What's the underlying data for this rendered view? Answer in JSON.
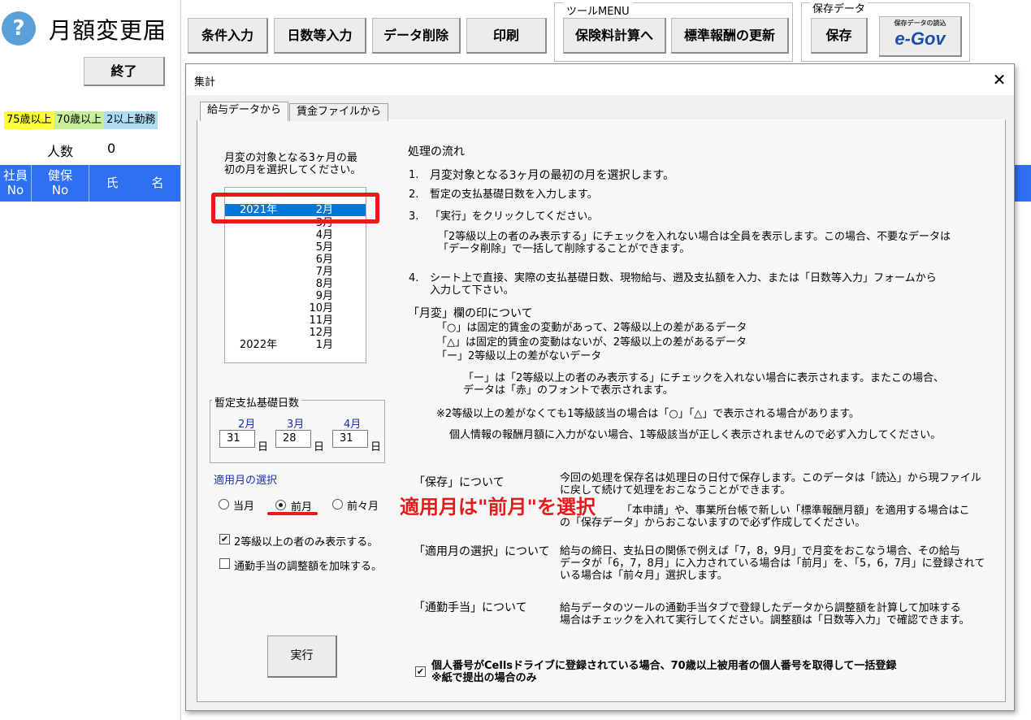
{
  "sheet": {
    "title": "月額変更届",
    "help_glyph": "?",
    "end_button": "終了",
    "age_legend": [
      "75歳以上",
      "70歳以上",
      "2以上勤務"
    ],
    "count_label": "人数",
    "count_value": "0",
    "headers": [
      "社員\nNo",
      "健保\nNo",
      "氏",
      "名"
    ]
  },
  "toolbar": {
    "buttons": [
      "条件入力",
      "日数等入力",
      "データ削除",
      "印刷"
    ],
    "tool_menu_label": "ツールMENU",
    "tool_menu_buttons": [
      "保険料計算へ",
      "標準報酬の更新"
    ],
    "save_group_label": "保存データ",
    "save_button": "保存",
    "egov_caption": "保存データの読込",
    "egov_logo": "e-Gov"
  },
  "dialog": {
    "title": "集計",
    "close_glyph": "✕",
    "tabs": [
      "給与データから",
      "賃金ファイルから"
    ],
    "month_prompt_line1": "月変の対象となる3ヶ月の最",
    "month_prompt_line2": "初の月を選択してください。",
    "month_list": [
      {
        "year": "2021年",
        "month": "2月"
      },
      {
        "year": "",
        "month": "3月"
      },
      {
        "year": "",
        "month": "4月"
      },
      {
        "year": "",
        "month": "5月"
      },
      {
        "year": "",
        "month": "6月"
      },
      {
        "year": "",
        "month": "7月"
      },
      {
        "year": "",
        "month": "8月"
      },
      {
        "year": "",
        "month": "9月"
      },
      {
        "year": "",
        "month": "10月"
      },
      {
        "year": "",
        "month": "11月"
      },
      {
        "year": "",
        "month": "12月"
      },
      {
        "year": "2022年",
        "month": "1月"
      }
    ],
    "selected_month_index": 0,
    "provisional_days_label": "暫定支払基礎日数",
    "provisional_days": [
      {
        "month": "2月",
        "value": "31"
      },
      {
        "month": "3月",
        "value": "28"
      },
      {
        "month": "4月",
        "value": "31"
      }
    ],
    "day_unit": "日",
    "apply_month_label": "適用月の選択",
    "apply_options": [
      "当月",
      "前月",
      "前々月"
    ],
    "apply_selected": "前月",
    "callout_text": "適用月は\"前月\"を選択",
    "checkbox_grade2": {
      "label": "2等級以上の者のみ表示する。",
      "checked": true
    },
    "checkbox_commute": {
      "label": "通勤手当の調整額を加味する。",
      "checked": false
    },
    "execute_button": "実行",
    "bottom_checkbox": {
      "line1": "個人番号がCellsドライブに登録されている場合、70歳以上被用者の個人番号を取得して一括登録",
      "line2": "※紙で提出の場合のみ",
      "checked": true
    }
  },
  "flow": {
    "heading": "処理の流れ",
    "step1_num": "1.",
    "step1": "月変対象となる3ヶ月の最初の月を選択します。",
    "step2_num": "2.",
    "step2": "暫定の支払基礎日数を入力します。",
    "step3_num": "3.",
    "step3": "「実行」をクリックしてください。",
    "step3_note1": "「2等級以上の者のみ表示する」にチェックを入れない場合は全員を表示します。この場合、不要なデータは",
    "step3_note2": "「データ削除」で一括して削除することができます。",
    "step4_num": "4.",
    "step4_line1": "シート上で直接、実際の支払基礎日数、現物給与、遡及支払額を入力、または「日数等入力」フォームから",
    "step4_line2": "入力して下さい。",
    "mark_heading": "「月変」欄の印について",
    "mark1": "「○」は固定的賃金の変動があって、2等級以上の差があるデータ",
    "mark2": "「△」は固定的賃金の変動はないが、2等級以上の差があるデータ",
    "mark3": "「ー」2等級以上の差がないデータ",
    "mark_note1": "「ー」は「2等級以上の者のみ表示する」にチェックを入れない場合に表示されます。またこの場合、",
    "mark_note2": "データは「赤」のフォントで表示されます。",
    "note_grade1": "※2等級以上の差がなくても1等級該当の場合は「○」「△」で表示される場合があります。",
    "note_personal": "個人情報の報酬月額に入力がない場合、1等級該当が正しく表示されませんので必ず入力してください。",
    "save_heading": "「保存」について",
    "save_line1": "今回の処理を保存名は処理日の日付で保存します。このデータは「読込」から現ファイル",
    "save_line2": "に戻して続けて処理をおこなうことができます。",
    "save_line3": "「本申請」や、事業所台帳で新しい「標準報酬月額」を適用する場合はこ",
    "save_line4": "の「保存データ」からおこないますので必ず作成してください。",
    "apply_heading": "「適用月の選択」について",
    "apply_line1": "給与の締日、支払日の関係で例えば「7，8，9月」で月変をおこなう場合、その給与",
    "apply_line2": "データが「6，7，8月」に入力されている場合は「前月」を、「5，6，7月」に登録されて",
    "apply_line3": "いる場合は「前々月」選択します。",
    "commute_heading": "「通勤手当」について",
    "commute_line1": "給与データのツールの通勤手当タブで登録したデータから調整額を計算して加味する",
    "commute_line2": "場合はチェックを入れて実行してください。調整額は「日数等入力」で確認できます。"
  },
  "colors": {
    "header_blue": "#2f6ff2",
    "selection_blue": "#0078d7",
    "annotation_red": "#e51a1a",
    "label_blue": "#1a2cb4"
  }
}
